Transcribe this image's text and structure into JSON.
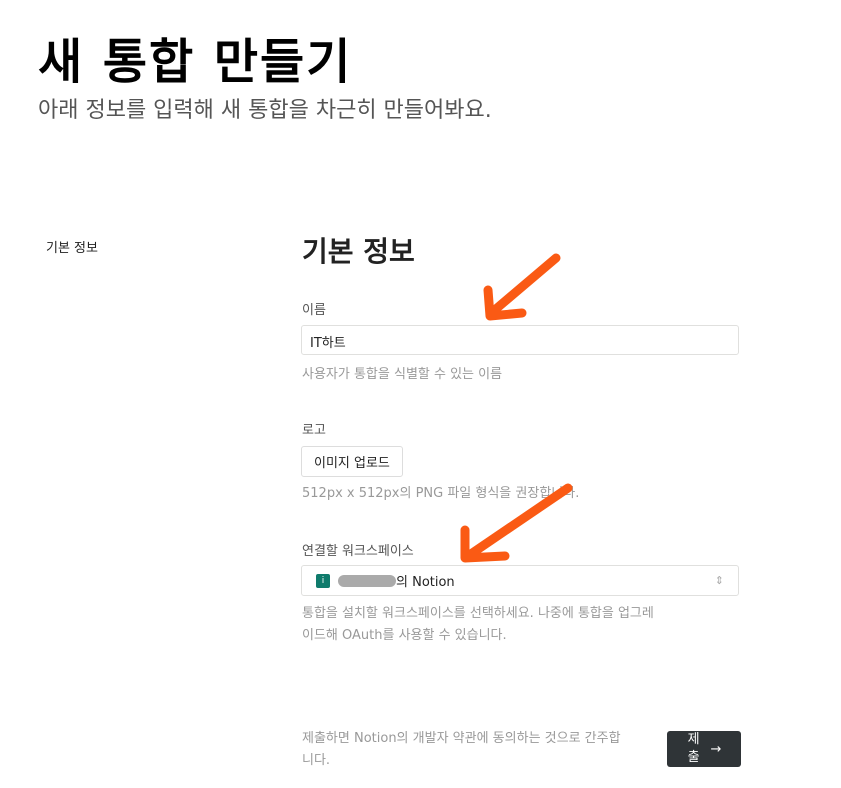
{
  "header": {
    "title": "새 통합 만들기",
    "subtitle": "아래 정보를 입력해 새 통합을 차근히 만들어봐요."
  },
  "sidebar": {
    "section": "기본 정보"
  },
  "form": {
    "section_title": "기본 정보",
    "name": {
      "label": "이름",
      "value": "IT하트",
      "hint": "사용자가 통합을 식별할 수 있는 이름"
    },
    "logo": {
      "label": "로고",
      "button": "이미지 업로드",
      "hint": "512px x 512px의 PNG 파일 형식을 권장합니다."
    },
    "workspace": {
      "label": "연결할 워크스페이스",
      "icon_letter": "i",
      "value_suffix": "의 Notion",
      "hint_line1": "통합을 설치할 워크스페이스를 선택하세요. 나중에 통합을 업그레",
      "hint_line2": "이드해 OAuth를 사용할 수 있습니다."
    }
  },
  "footer": {
    "terms_prefix": "제출하면 Notion의 ",
    "terms_link": "개발자 약관",
    "terms_suffix": "에 동의하는 것으로 간주합니다.",
    "submit": "제출"
  },
  "colors": {
    "annotation_arrow": "#fa5a14",
    "submit_bg": "#2f3437",
    "workspace_icon": "#0f7b6c"
  }
}
